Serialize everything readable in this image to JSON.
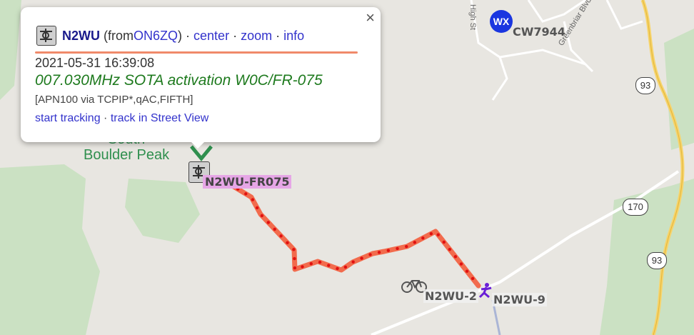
{
  "colors": {
    "track": "#f26b4d",
    "track_dot": "#e01010",
    "popup_rule": "#f08a6a",
    "comment": "#1e7a1e",
    "link": "#3333cc",
    "wx": "#1a36e0",
    "map_bg": "#e8e6e1",
    "forest": "#c7dfc0"
  },
  "map": {
    "place_label": "South\nBoulder Peak",
    "roads": {
      "high_st": "High St",
      "greenbriar": "Greenbriar Blvd"
    },
    "shields": [
      "93",
      "170",
      "93"
    ],
    "stations": {
      "wx_badge": "WX",
      "wx_station": "CW7944",
      "object": "N2WU-FR075",
      "bike": "N2WU-2",
      "hiker": "N2WU-9"
    }
  },
  "popup": {
    "callsign": "N2WU",
    "from_prefix": "(from ",
    "from_call": "ON6ZQ",
    "from_suffix": ")",
    "sep": " · ",
    "links": {
      "center": "center",
      "zoom": "zoom",
      "info": "info"
    },
    "timestamp": "2021-05-31 16:39:08",
    "comment": "007.030MHz SOTA activation W0C/FR-075",
    "path": "[APN100 via TCPIP*,qAC,FIFTH]",
    "start_tracking": "start tracking",
    "street_view": "track in Street View",
    "close": "×"
  }
}
